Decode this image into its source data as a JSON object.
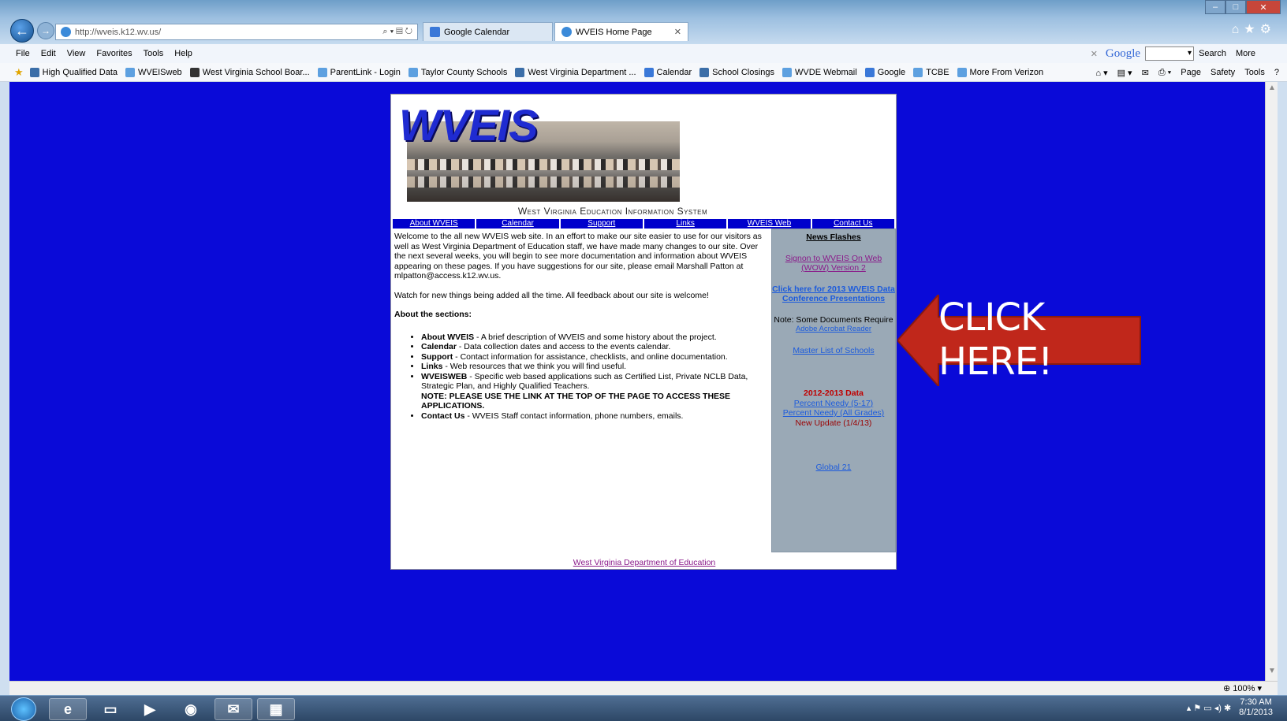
{
  "browser": {
    "address": "http://wveis.k12.wv.us/",
    "tabs": [
      {
        "label": "Google Calendar",
        "active": false
      },
      {
        "label": "WVEIS Home Page",
        "active": true
      }
    ],
    "menu": [
      "File",
      "Edit",
      "View",
      "Favorites",
      "Tools",
      "Help"
    ],
    "google_toolbar": {
      "logo": "Google",
      "search_label": "Search",
      "more_label": "More"
    },
    "favorites": [
      "High Qualified Data",
      "WVEISweb",
      "West Virginia School Boar...",
      "ParentLink - Login",
      "Taylor County Schools",
      "West Virginia Department ...",
      "Calendar",
      "School Closings",
      "WVDE Webmail",
      "Google",
      "TCBE",
      "More From Verizon"
    ],
    "command_bar": [
      "Page",
      "Safety",
      "Tools"
    ],
    "zoom": "100%"
  },
  "page": {
    "logo": "WVEIS",
    "subtitle": "West Virginia Education Information System",
    "nav": [
      "About WVEIS",
      "Calendar",
      "Support",
      "Links",
      "WVEIS Web",
      "Contact Us"
    ],
    "intro": "Welcome to the all new WVEIS web site.  In an effort to make our site easier to use for our visitors as well as West Virginia Department of Education staff, we have made many changes to our site.  Over the next several weeks, you will begin to see more documentation and information about WVEIS appearing on these pages.  If you have suggestions for our site, please email Marshall Patton at mlpatton@access.k12.wv.us.",
    "watch": "Watch for new things being added all the time.  All feedback about our site is welcome!",
    "sections_heading": "About the sections:",
    "sections": [
      {
        "term": "About WVEIS",
        "desc": " - A brief description of WVEIS and some history about the project."
      },
      {
        "term": "Calendar",
        "desc": " - Data collection dates and access to the events calendar."
      },
      {
        "term": "Support",
        "desc": " - Contact information for assistance, checklists, and online documentation."
      },
      {
        "term": "Links",
        "desc": " - Web resources that we think you will find useful."
      },
      {
        "term": "WVEISWEB",
        "desc": " - Specific web based applications such as Certified List, Private NCLB Data, Strategic Plan, and Highly Qualified Teachers."
      },
      {
        "term": "Contact Us",
        "desc": " - WVEIS Staff contact information, phone numbers, emails."
      }
    ],
    "note": "NOTE: PLEASE USE THE LINK AT THE TOP OF THE PAGE TO ACCESS THESE APPLICATIONS.",
    "sidebar": {
      "heading": "News Flashes",
      "signon_line1": "Signon to WVEIS On Web",
      "signon_line2": "(WOW) Version 2",
      "conf_line1": "Click here for 2013 WVEIS Data",
      "conf_line2": "Conference Presentations",
      "note": "Note: Some Documents Require",
      "acrobat": "Adobe Acrobat Reader",
      "master": "Master List of Schools",
      "data_heading": "2012-2013 Data",
      "needy1": "Percent Needy (5-17)",
      "needy2": "Percent Needy (All Grades)",
      "update": "New Update (1/4/13)",
      "global": "Global 21"
    },
    "footer_link": "West Virginia Department of Education"
  },
  "callout": {
    "label": "CLICK HERE!",
    "color": "#c0271b"
  },
  "taskbar": {
    "time": "7:30 AM",
    "date": "8/1/2013"
  }
}
